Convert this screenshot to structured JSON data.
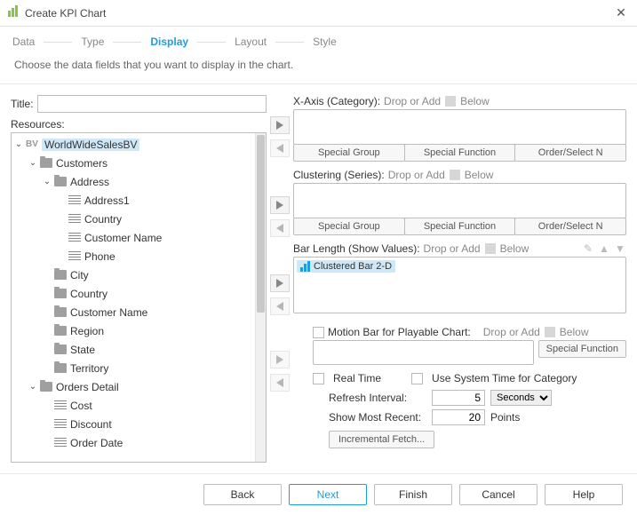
{
  "window": {
    "title": "Create KPI Chart"
  },
  "steps": {
    "items": [
      "Data",
      "Type",
      "Display",
      "Layout",
      "Style"
    ],
    "active": "Display"
  },
  "subtitle": "Choose the data fields that you want to display in the chart.",
  "left": {
    "title_label": "Title:",
    "title_value": "",
    "resources_label": "Resources:"
  },
  "tree": {
    "root": "WorldWideSalesBV",
    "customers": "Customers",
    "address": "Address",
    "address_fields": [
      "Address1",
      "Country",
      "Customer Name",
      "Phone"
    ],
    "customer_fields": [
      "City",
      "Country",
      "Customer Name",
      "Region",
      "State",
      "Territory"
    ],
    "orders": "Orders Detail",
    "order_fields": [
      "Cost",
      "Discount",
      "Order Date"
    ]
  },
  "drops": {
    "xaxis_label": "X-Axis (Category):",
    "clustering_label": "Clustering (Series):",
    "barlen_label": "Bar Length (Show Values):",
    "motion_label": "Motion Bar for Playable Chart:",
    "drop_hint": "Drop or Add",
    "below": "Below",
    "special_group": "Special Group",
    "special_function": "Special Function",
    "order_select_n": "Order/Select N",
    "barlen_value": "Clustered Bar 2-D"
  },
  "realtime": {
    "real_time": "Real Time",
    "use_system_time": "Use System Time for Category",
    "refresh_label": "Refresh Interval:",
    "refresh_value": "5",
    "refresh_unit": "Seconds",
    "recent_label": "Show Most Recent:",
    "recent_value": "20",
    "recent_unit": "Points",
    "incremental": "Incremental Fetch..."
  },
  "footer": {
    "back": "Back",
    "next": "Next",
    "finish": "Finish",
    "cancel": "Cancel",
    "help": "Help"
  }
}
